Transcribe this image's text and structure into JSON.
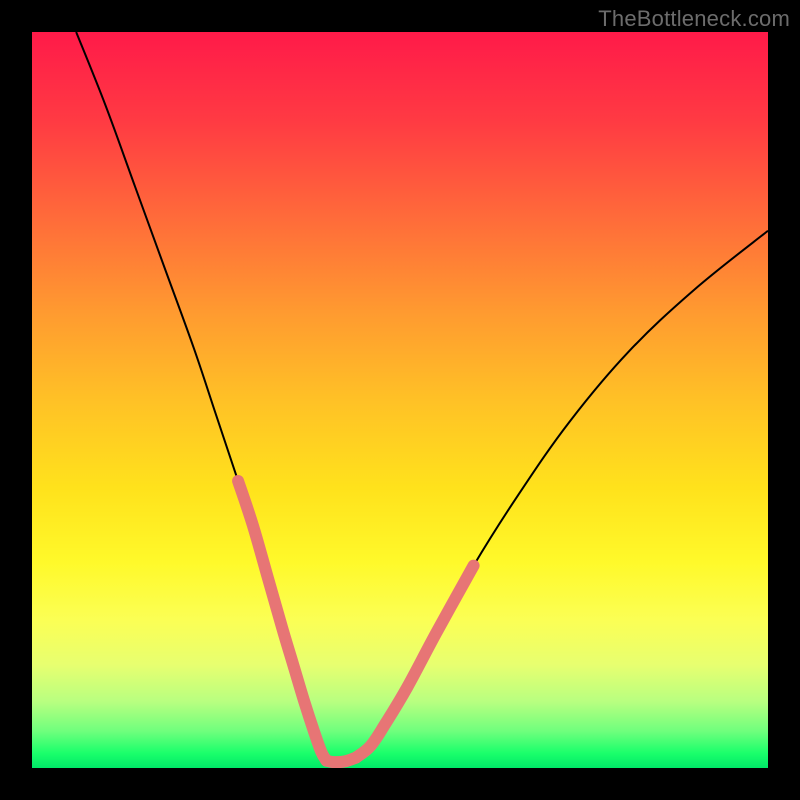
{
  "watermark": "TheBottleneck.com",
  "chart_data": {
    "type": "line",
    "title": "",
    "xlabel": "",
    "ylabel": "",
    "xlim": [
      0,
      100
    ],
    "ylim": [
      0,
      100
    ],
    "grid": false,
    "legend": false,
    "background_gradient": [
      "#ff1a49",
      "#ffc126",
      "#fff92a",
      "#00e867"
    ],
    "series": [
      {
        "name": "main-curve",
        "color": "#000000",
        "stroke_width": 2,
        "x": [
          6,
          10,
          14,
          18,
          22,
          25,
          28,
          30,
          32,
          34,
          35.5,
          37,
          38.3,
          39.3,
          40,
          41,
          42.5,
          44,
          46,
          48,
          51,
          55,
          60,
          66,
          73,
          81,
          90,
          100
        ],
        "values": [
          100,
          90,
          79,
          68,
          57,
          48,
          39,
          33,
          26,
          19,
          14,
          9,
          5,
          2.2,
          1,
          0.8,
          0.9,
          1.4,
          3,
          6,
          11,
          18.5,
          27.5,
          37,
          47,
          56.5,
          65,
          73
        ]
      },
      {
        "name": "highlight-segment-left",
        "color": "#e77575",
        "stroke_width": 12,
        "stroke_linecap": "round",
        "x": [
          28,
          30,
          32,
          34,
          35.5,
          37,
          38.3,
          39.3,
          40
        ],
        "values": [
          39,
          33,
          26,
          19,
          14,
          9,
          5,
          2.2,
          1
        ]
      },
      {
        "name": "highlight-segment-bottom",
        "color": "#e77575",
        "stroke_width": 12,
        "stroke_linecap": "round",
        "x": [
          40,
          41,
          42.5,
          44
        ],
        "values": [
          1,
          0.8,
          0.9,
          1.4
        ]
      },
      {
        "name": "highlight-segment-right",
        "color": "#e77575",
        "stroke_width": 12,
        "stroke_linecap": "round",
        "x": [
          44,
          46,
          48,
          51,
          55,
          60
        ],
        "values": [
          1.4,
          3,
          6,
          11,
          18.5,
          27.5
        ]
      }
    ]
  }
}
